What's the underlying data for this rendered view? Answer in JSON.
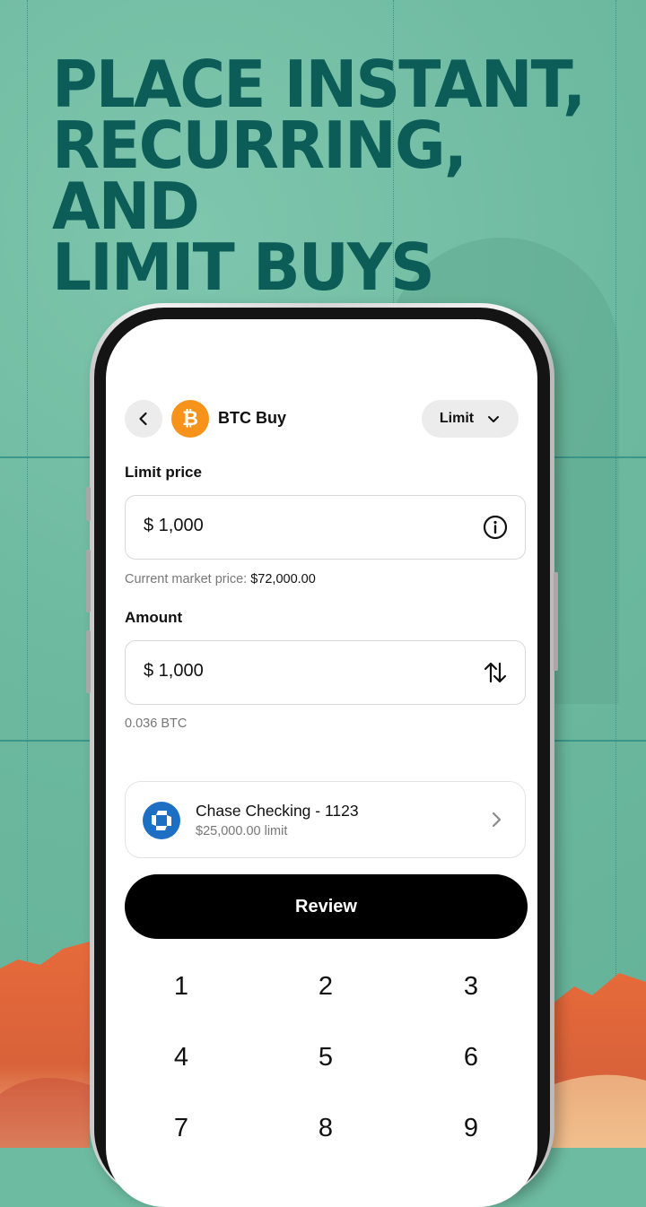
{
  "headline": {
    "line1": "PLACE INSTANT,",
    "line2": "RECURRING, AND",
    "line3": "LIMIT BUYS"
  },
  "colors": {
    "background": "#6dbba1",
    "headline": "#0c5c58",
    "bitcoin": "#f7931a",
    "bank": "#1c6fc3",
    "mountains": "#e06a3d"
  },
  "app": {
    "header": {
      "back_icon": "chevron-left-icon",
      "asset_icon": "bitcoin-icon",
      "asset_symbol": "₿",
      "title": "BTC Buy",
      "order_type": "Limit",
      "order_type_icon": "chevron-down-icon"
    },
    "limit_price": {
      "label": "Limit price",
      "value": "$ 1,000",
      "icon": "info-icon",
      "market_prefix": "Current market price: ",
      "market_value": "$72,000.00"
    },
    "amount": {
      "label": "Amount",
      "value": "$ 1,000",
      "icon": "swap-arrows-icon",
      "converted": "0.036 BTC"
    },
    "funding": {
      "icon": "chase-logo-icon",
      "name": "Chase Checking - 1123",
      "limit": "$25,000.00 limit",
      "chevron": "chevron-right-icon"
    },
    "review_label": "Review",
    "keypad": [
      "1",
      "2",
      "3",
      "4",
      "5",
      "6",
      "7",
      "8",
      "9"
    ]
  }
}
